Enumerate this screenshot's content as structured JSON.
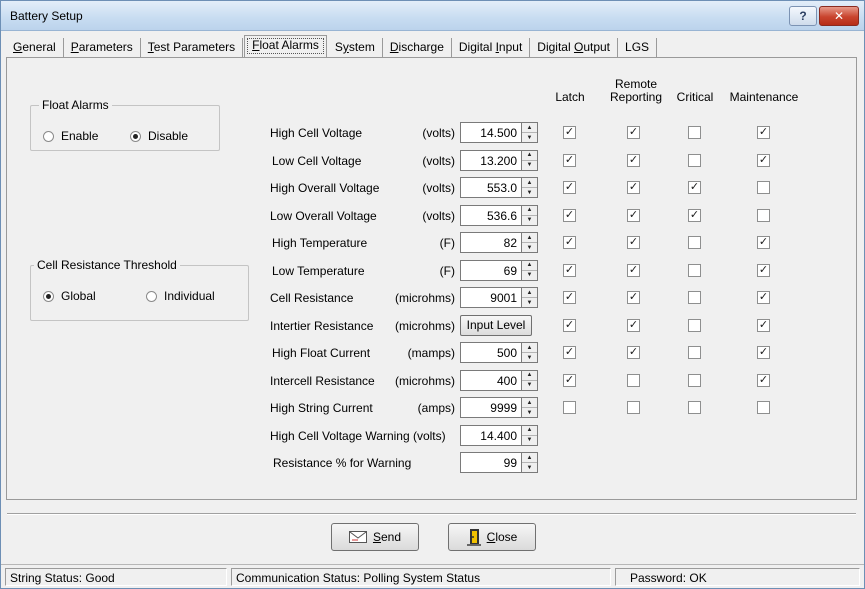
{
  "window": {
    "title": "Battery Setup"
  },
  "titlebar": {
    "help": "?",
    "close": "✕"
  },
  "tabs": [
    {
      "label": "General",
      "ul": "G",
      "rest": "eneral"
    },
    {
      "label": "Parameters",
      "ul": "P",
      "rest": "arameters"
    },
    {
      "label": "Test Parameters",
      "ul": "T",
      "rest": "est Parameters"
    },
    {
      "label": "Float Alarms",
      "ul": "F",
      "rest": "loat Alarms"
    },
    {
      "label": "System",
      "pre": "S",
      "ul": "y",
      "rest": "stem"
    },
    {
      "label": "Discharge",
      "ul": "D",
      "rest": "ischarge"
    },
    {
      "label": "Digital Input",
      "pre": "Digital ",
      "ul": "I",
      "rest": "nput"
    },
    {
      "label": "Digital Output",
      "pre": "Digital ",
      "ul": "O",
      "rest": "utput"
    },
    {
      "label": "LGS",
      "ul": "",
      "rest": "LGS"
    }
  ],
  "float_alarms_group": {
    "legend": "Float Alarms",
    "enable": "Enable",
    "disable": "Disable",
    "selected": "Disable"
  },
  "cell_resistance_group": {
    "legend": "Cell Resistance Threshold",
    "global": "Global",
    "individual": "Individual",
    "selected": "Global"
  },
  "columns": {
    "latch": "Latch",
    "remote_line1": "Remote",
    "remote_line2": "Reporting",
    "critical": "Critical",
    "maintenance": "Maintenance"
  },
  "rows": [
    {
      "label": "High Cell Voltage",
      "unit": "(volts)",
      "value": "14.500",
      "latch": true,
      "remote": true,
      "critical": false,
      "maintenance": true
    },
    {
      "label": "Low Cell Voltage",
      "unit": "(volts)",
      "value": "13.200",
      "latch": true,
      "remote": true,
      "critical": false,
      "maintenance": true
    },
    {
      "label": "High Overall Voltage",
      "unit": "(volts)",
      "value": "553.0",
      "latch": true,
      "remote": true,
      "critical": true,
      "maintenance": false
    },
    {
      "label": "Low Overall Voltage",
      "unit": "(volts)",
      "value": "536.6",
      "latch": true,
      "remote": true,
      "critical": true,
      "maintenance": false
    },
    {
      "label": "High Temperature",
      "unit": "(F)",
      "value": "82",
      "latch": true,
      "remote": true,
      "critical": false,
      "maintenance": true
    },
    {
      "label": "Low Temperature",
      "unit": "(F)",
      "value": "69",
      "latch": true,
      "remote": true,
      "critical": false,
      "maintenance": true
    },
    {
      "label": "Cell Resistance",
      "unit": "(microhms)",
      "value": "9001",
      "latch": true,
      "remote": true,
      "critical": false,
      "maintenance": true
    },
    {
      "label": "Intertier Resistance",
      "unit": "(microhms)",
      "button": "Input Level",
      "latch": true,
      "remote": true,
      "critical": false,
      "maintenance": true
    },
    {
      "label": "High Float Current",
      "unit": "(mamps)",
      "value": "500",
      "latch": true,
      "remote": true,
      "critical": false,
      "maintenance": true
    },
    {
      "label": "Intercell Resistance",
      "unit": "(microhms)",
      "value": "400",
      "latch": true,
      "remote": false,
      "critical": false,
      "maintenance": true
    },
    {
      "label": "High String  Current",
      "unit": "(amps)",
      "value": "9999",
      "latch": false,
      "remote": false,
      "critical": false,
      "maintenance": false
    },
    {
      "label": "High Cell Voltage Warning (volts)",
      "unit": "",
      "value": "14.400"
    },
    {
      "label": "Resistance % for Warning",
      "unit": "",
      "value": "99"
    }
  ],
  "buttons": {
    "send_ul": "S",
    "send_rest": "end",
    "close_ul": "C",
    "close_rest": "lose"
  },
  "status": {
    "string": "String Status: Good",
    "communication": "Communication Status: Polling System Status",
    "password": "Password: OK"
  },
  "colors": {
    "titlebar": "#c7dcf1",
    "close_button": "#c9442e",
    "face": "#f0f0f0"
  }
}
